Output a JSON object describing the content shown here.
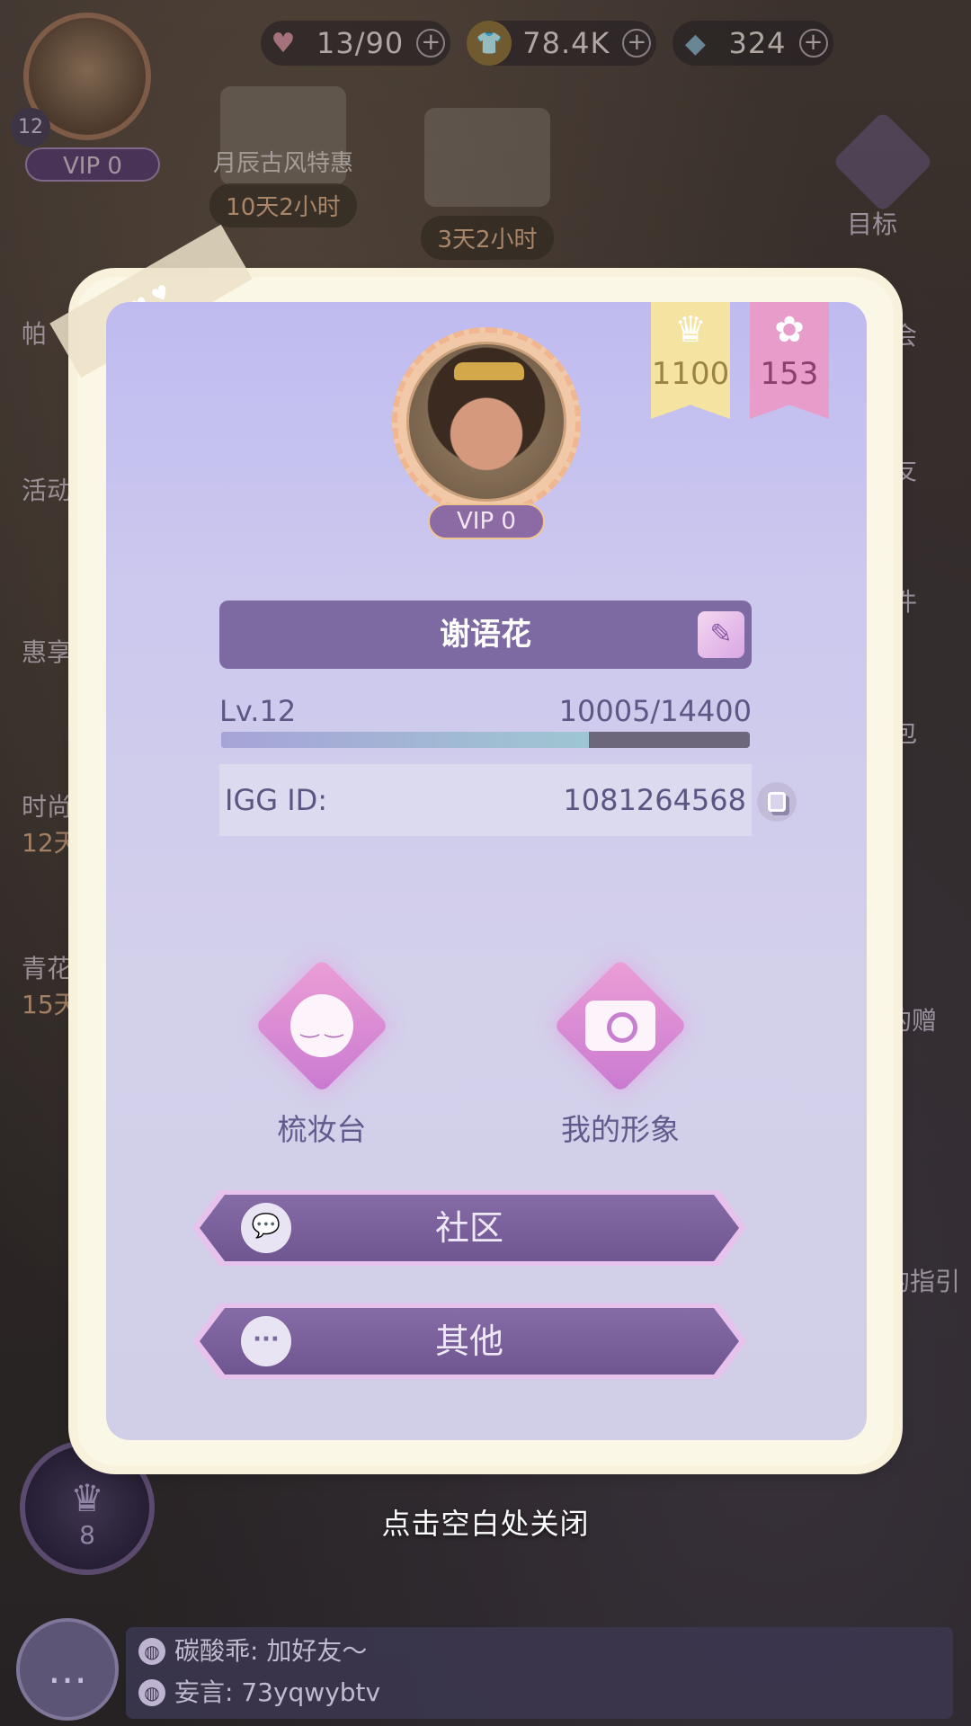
{
  "resources": {
    "hearts": {
      "icon": "heart-icon",
      "value": "13/90"
    },
    "coins": {
      "icon": "coin-shirt-icon",
      "value": "78.4K"
    },
    "gems": {
      "icon": "diamond-icon",
      "value": "324"
    }
  },
  "mini_avatar": {
    "level": "12",
    "vip": "VIP 0"
  },
  "events": [
    {
      "title": "月辰古风特惠",
      "timer": "10天2小时"
    },
    {
      "title": "",
      "timer": "3天2小时"
    }
  ],
  "side_right": {
    "goal": "目标",
    "party": "会",
    "friends": "友",
    "mail": "件",
    "bag": "包",
    "gift": "的赠",
    "guide": "的指引"
  },
  "side_left": {
    "pa": "帕",
    "activity": "活动",
    "benefit": "惠享",
    "fashion": "时尚",
    "fashion_timer": "12天",
    "qinghua": "青花",
    "qinghua_timer": "15天"
  },
  "profile": {
    "ribbons": [
      {
        "icon": "crown-icon",
        "value": "1100",
        "color": "#f5e3a2"
      },
      {
        "icon": "dress-icon",
        "value": "153",
        "color": "#e89cc9"
      }
    ],
    "vip": "VIP 0",
    "name": "谢语花",
    "level_label": "Lv.12",
    "xp_text": "10005/14400",
    "xp_fraction": 0.695,
    "igg_label": "IGG ID:",
    "igg_value": "1081264568",
    "actions": [
      {
        "icon": "dressing-table-icon",
        "label": "梳妆台"
      },
      {
        "icon": "camera-icon",
        "label": "我的形象"
      }
    ],
    "community_label": "社区",
    "other_label": "其他"
  },
  "guild": {
    "level": "8"
  },
  "close_hint": "点击空白处关闭",
  "chat": [
    {
      "text": "碳酸乖: 加好友～"
    },
    {
      "text": "妄言: 73yqwybtv"
    }
  ],
  "colors": {
    "panel_top": "#bfbbf0",
    "name_bar": "#7d6aa2",
    "button": "#7a61a0"
  }
}
